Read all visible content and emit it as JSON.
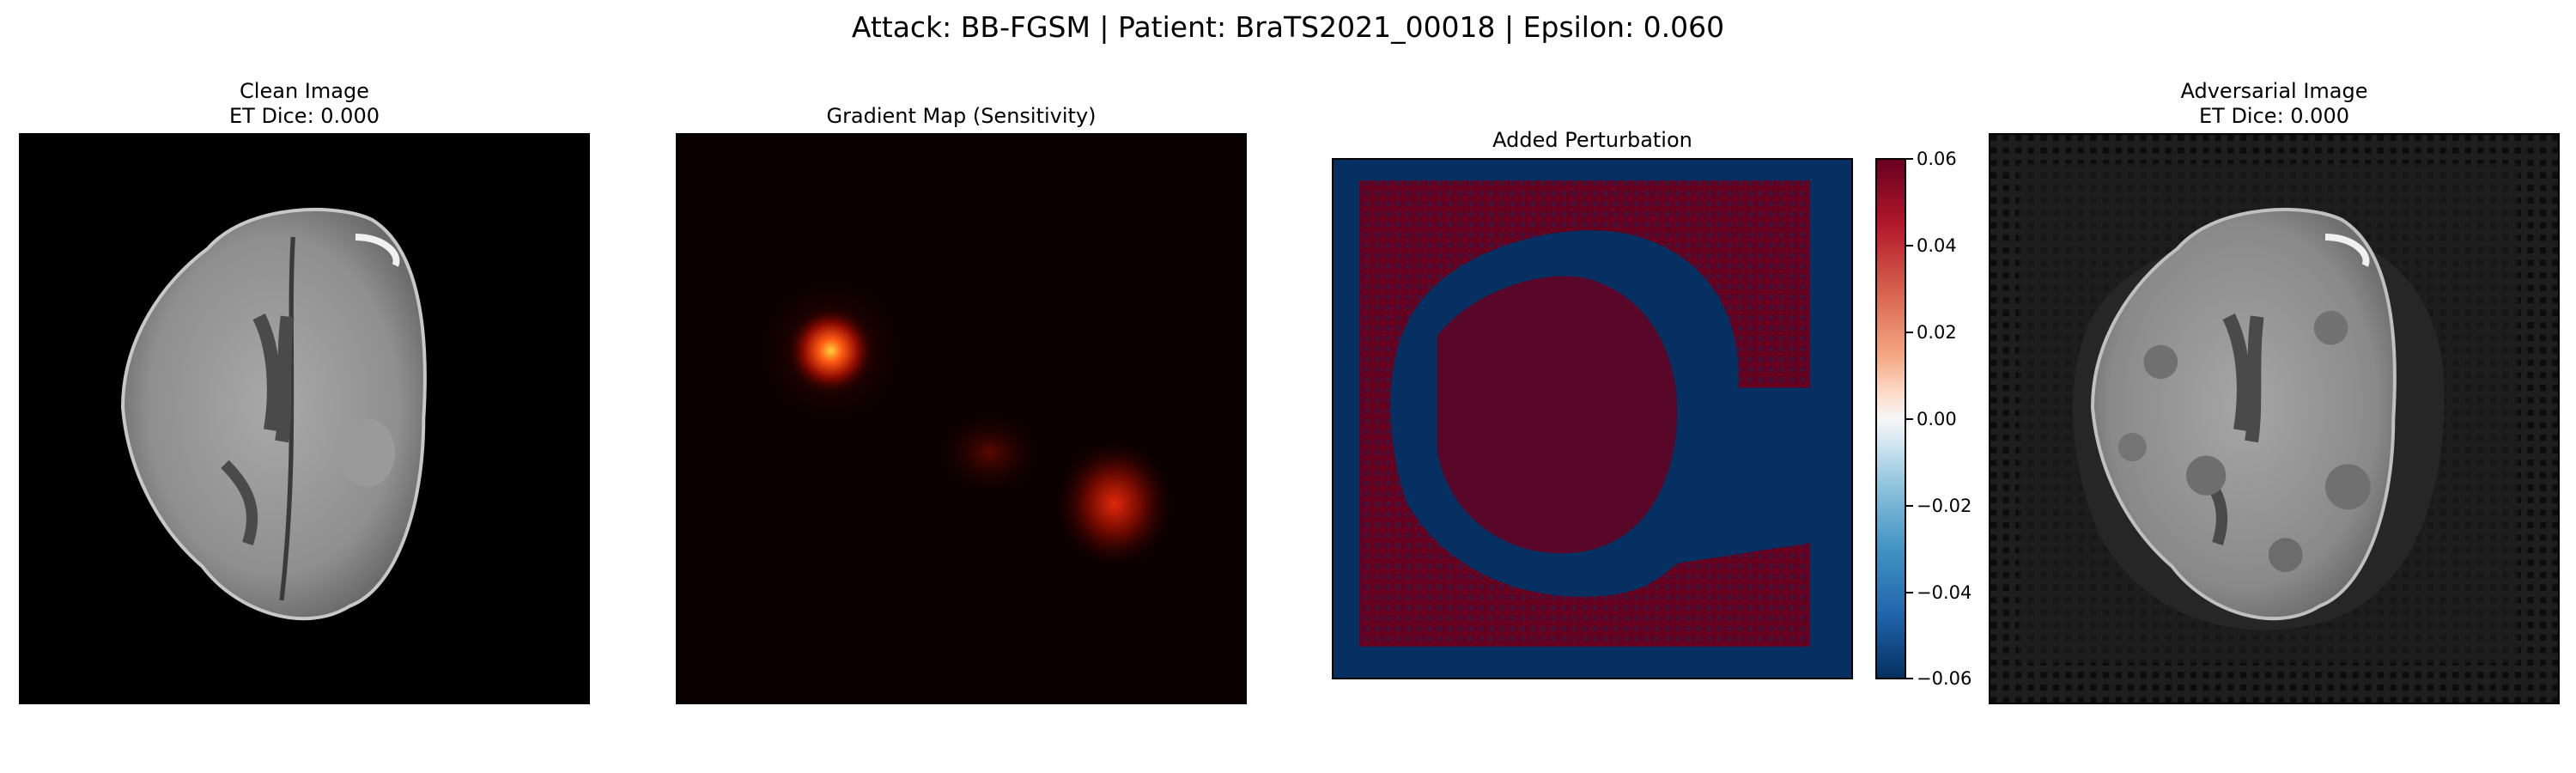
{
  "figure": {
    "suptitle": "Attack: BB-FGSM | Patient: BraTS2021_00018 | Epsilon: 0.060"
  },
  "panels": {
    "clean": {
      "title": "Clean Image",
      "subtitle": "ET Dice: 0.000",
      "cmap": "gray"
    },
    "gradient": {
      "title": "Gradient Map (Sensitivity)",
      "cmap": "hot"
    },
    "perturbation": {
      "title": "Added Perturbation",
      "cmap": "RdBu_r"
    },
    "adversarial": {
      "title": "Adversarial Image",
      "subtitle": "ET Dice: 0.000",
      "cmap": "gray"
    }
  },
  "colorbar": {
    "range": [
      -0.06,
      0.06
    ],
    "ticks": [
      "0.06",
      "0.04",
      "0.02",
      "0.00",
      "−0.02",
      "−0.04",
      "−0.06"
    ]
  },
  "colors": {
    "perturb_positive": "#67001f",
    "perturb_negative": "#053061",
    "gradient_background": "#0a0000",
    "gradient_hot": "#ffd23c"
  }
}
